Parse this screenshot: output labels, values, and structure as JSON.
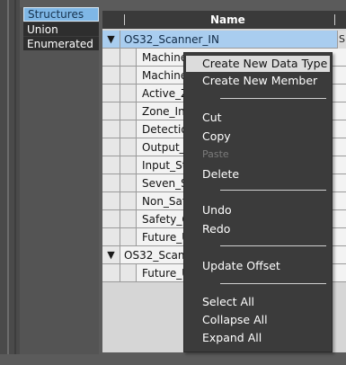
{
  "categories": [
    {
      "label": "Structures",
      "selected": true
    },
    {
      "label": "Union",
      "selected": false
    },
    {
      "label": "Enumerated",
      "selected": false
    }
  ],
  "grid": {
    "header": {
      "name": "Name"
    },
    "rows": [
      {
        "type": "parent",
        "expander": "▼",
        "name": "OS32_Scanner_IN",
        "tail": "S",
        "selected": true
      },
      {
        "type": "child",
        "name": "Machine_Status"
      },
      {
        "type": "child",
        "name": "Machine_Ready"
      },
      {
        "type": "child",
        "name": "Active_Zone"
      },
      {
        "type": "child",
        "name": "Zone_Input"
      },
      {
        "type": "child",
        "name": "Detection_Zone"
      },
      {
        "type": "child",
        "name": "Output_Status"
      },
      {
        "type": "child",
        "name": "Input_Status"
      },
      {
        "type": "child",
        "name": "Seven_Segment"
      },
      {
        "type": "child",
        "name": "Non_Safety"
      },
      {
        "type": "child",
        "name": "Safety_Output"
      },
      {
        "type": "child",
        "name": "Future_Use"
      },
      {
        "type": "parent",
        "expander": "▼",
        "name": "OS32_Scanner_OUT",
        "tail": "",
        "selected": false
      },
      {
        "type": "child",
        "name": "Future_Use"
      }
    ]
  },
  "context_menu": {
    "items": [
      {
        "label": "Create New Data Type",
        "state": "highlight"
      },
      {
        "label": "Create New Member",
        "state": "normal"
      },
      {
        "separator": true
      },
      {
        "label": "Cut",
        "state": "normal"
      },
      {
        "label": "Copy",
        "state": "normal"
      },
      {
        "label": "Paste",
        "state": "disabled"
      },
      {
        "label": "Delete",
        "state": "normal"
      },
      {
        "separator": true
      },
      {
        "label": "Undo",
        "state": "normal"
      },
      {
        "label": "Redo",
        "state": "normal"
      },
      {
        "separator": true
      },
      {
        "label": "Update Offset",
        "state": "normal"
      },
      {
        "separator": true
      },
      {
        "label": "Select All",
        "state": "normal"
      },
      {
        "label": "Collapse All",
        "state": "normal"
      },
      {
        "label": "Expand All",
        "state": "normal"
      }
    ]
  }
}
